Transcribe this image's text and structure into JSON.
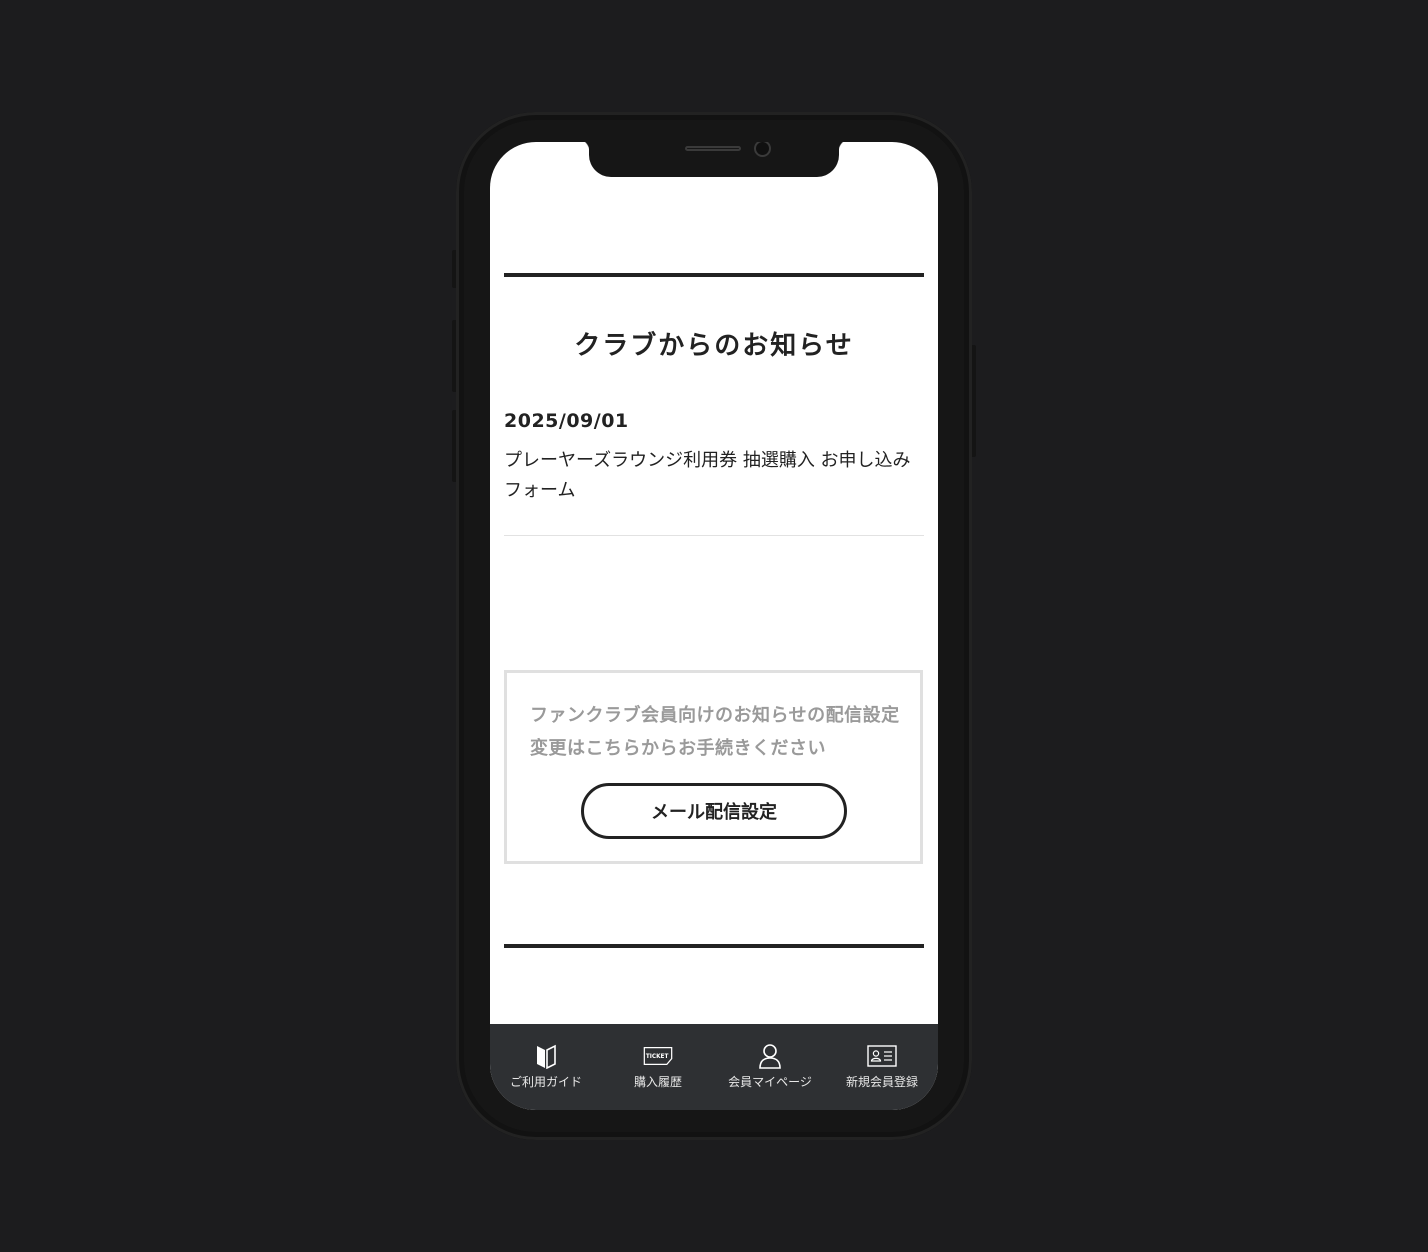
{
  "news": {
    "section_title": "クラブからのお知らせ",
    "items": [
      {
        "date": "2025/09/01",
        "title": "プレーヤーズラウンジ利用券 抽選購入 お申し込みフォーム"
      }
    ]
  },
  "mail_settings": {
    "description": "ファンクラブ会員向けのお知らせの配信設定変更はこちらからお手続きください",
    "button_label": "メール配信設定"
  },
  "tabbar": {
    "items": [
      {
        "label": "ご利用ガイド",
        "icon": "guide-book-icon"
      },
      {
        "label": "購入履歴",
        "icon": "ticket-icon",
        "icon_text": "TICKET"
      },
      {
        "label": "会員マイページ",
        "icon": "person-icon"
      },
      {
        "label": "新規会員登録",
        "icon": "id-card-icon"
      }
    ]
  },
  "colors": {
    "background": "#1c1c1e",
    "tabbar": "#2e3033",
    "text": "#222222",
    "muted_text": "#9a9a9a"
  }
}
